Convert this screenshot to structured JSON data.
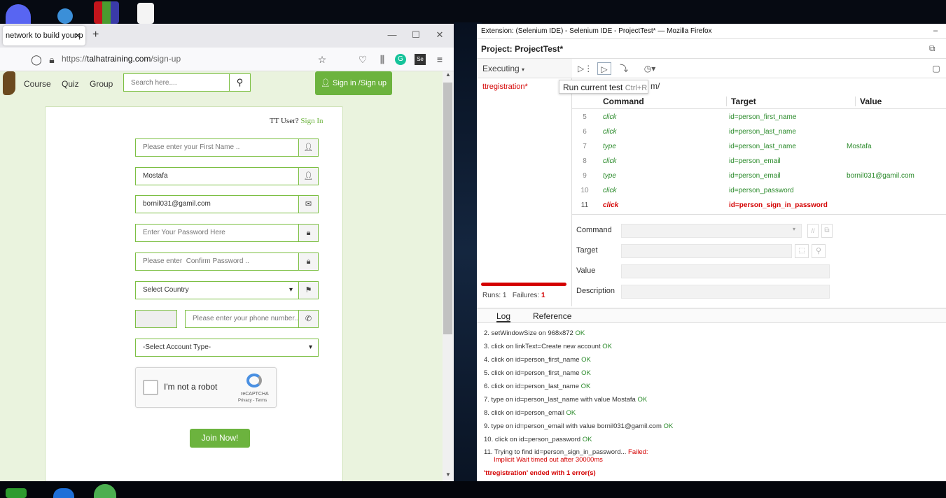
{
  "firefox": {
    "tab_title": "network to build your p",
    "url_prefix": "https://",
    "url_host": "talhatraining.com",
    "url_path": "/sign-up"
  },
  "site": {
    "nav": [
      "Course",
      "Quiz",
      "Group"
    ],
    "search_placeholder": "Search here....",
    "signin_button": "Sign in /Sign up",
    "tt_user": "TT User?",
    "sign_in_link": "Sign In",
    "fields": {
      "first_name_placeholder": "Please enter your First Name ..",
      "last_name_value": "Mostafa",
      "email_value": "bornil031@gamil.com",
      "password_placeholder": "Enter Your Password Here",
      "confirm_placeholder": "Please enter  Confirm Password ..",
      "country_select": "Select Country",
      "phone_placeholder": "Please enter your phone number..",
      "account_type_select": "-Select Account Type-"
    },
    "recaptcha": {
      "label": "I'm not a robot",
      "brand": "reCAPTCHA",
      "links": "Privacy - Terms"
    },
    "join_button": "Join Now!"
  },
  "ide": {
    "title": "Extension: (Selenium IDE) - Selenium IDE - ProjectTest* — Mozilla Firefox",
    "project": "Project:  ProjectTest*",
    "mode": "Executing",
    "test_name": "ttregistration*",
    "tooltip": "Run current test",
    "tooltip_shortcut": "Ctrl+R",
    "url_fragment": "m/",
    "headers": {
      "command": "Command",
      "target": "Target",
      "value": "Value"
    },
    "rows": [
      {
        "n": "5",
        "cmd": "click",
        "target": "id=person_first_name",
        "value": ""
      },
      {
        "n": "6",
        "cmd": "click",
        "target": "id=person_last_name",
        "value": ""
      },
      {
        "n": "7",
        "cmd": "type",
        "target": "id=person_last_name",
        "value": "Mostafa"
      },
      {
        "n": "8",
        "cmd": "click",
        "target": "id=person_email",
        "value": ""
      },
      {
        "n": "9",
        "cmd": "type",
        "target": "id=person_email",
        "value": "bornil031@gamil.com"
      },
      {
        "n": "10",
        "cmd": "click",
        "target": "id=person_password",
        "value": ""
      },
      {
        "n": "11",
        "cmd": "click",
        "target": "id=person_sign_in_password",
        "value": ""
      }
    ],
    "editor": {
      "command": "Command",
      "target": "Target",
      "value": "Value",
      "description": "Description"
    },
    "runs_label": "Runs: 1",
    "failures_label": "Failures:",
    "failures_count": "1",
    "log_tab": "Log",
    "reference_tab": "Reference",
    "log": [
      {
        "text": "2.  setWindowSize on 968x872",
        "status": "OK"
      },
      {
        "text": "3.  click on linkText=Create new account",
        "status": "OK"
      },
      {
        "text": "4.  click on id=person_first_name",
        "status": "OK"
      },
      {
        "text": "5.  click on id=person_first_name",
        "status": "OK"
      },
      {
        "text": "6.  click on id=person_last_name",
        "status": "OK"
      },
      {
        "text": "7.  type on id=person_last_name with value Mostafa",
        "status": "OK"
      },
      {
        "text": "8.  click on id=person_email",
        "status": "OK"
      },
      {
        "text": "9.  type on id=person_email with value bornil031@gamil.com",
        "status": "OK"
      },
      {
        "text": "10. click on id=person_password",
        "status": "OK"
      }
    ],
    "log_fail_line1": "11. Trying to find id=person_sign_in_password...",
    "log_fail_status": "Failed:",
    "log_fail_line2": "Implicit Wait timed out after 30000ms",
    "log_end": "'ttregistration' ended with 1 error(s)"
  }
}
